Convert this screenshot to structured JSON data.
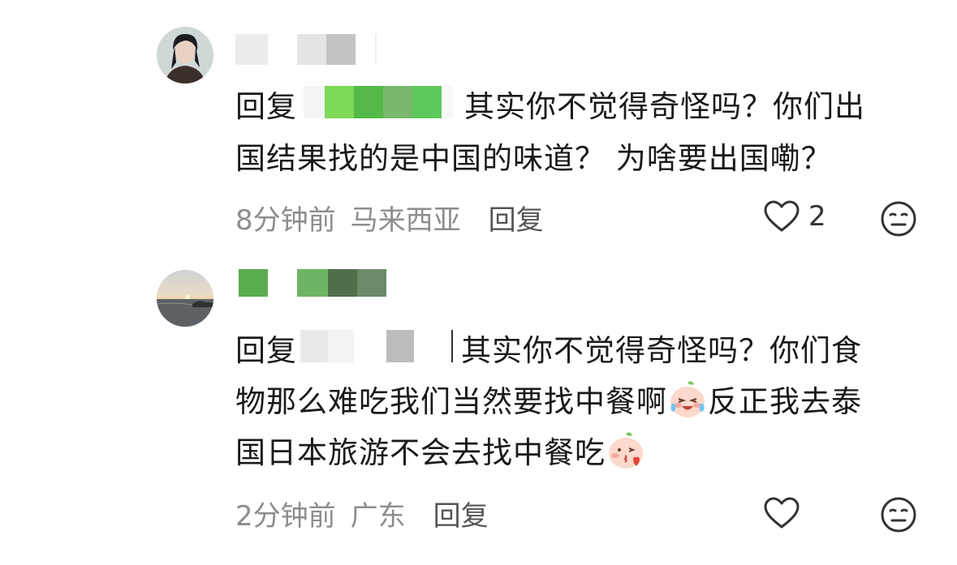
{
  "comments": [
    {
      "reply_prefix": "回复",
      "body_line1": "其实你不觉得奇怪吗？你们出",
      "body_line2": "国结果找的是中国的味道？ 为啥要出国嘞？",
      "time": "8分钟前",
      "location": "马来西亚",
      "reply_label": "回复",
      "like_count": "2",
      "avatar_icon": "man-portrait-avatar",
      "name_mask_colors": [
        "#ececec",
        "#ffffff",
        "#e4e4e4",
        "#c4c4c4",
        "#ffffff"
      ],
      "target_mask_colors": [
        "#7ed957",
        "#54b948",
        "#79b86c",
        "#5ec85a"
      ]
    },
    {
      "reply_prefix": "回复",
      "body_line1": "其实你不觉得奇怪吗？你们食",
      "body_line2": "物那么难吃我们当然要找中餐啊",
      "body_line2b": "反正我去泰",
      "body_line3": "国日本旅游不会去找中餐吃",
      "time": "2分钟前",
      "location": "广东",
      "reply_label": "回复",
      "like_count": "",
      "avatar_icon": "sunset-sea-avatar",
      "emoji1": "crying-laugh-peach-emoji",
      "emoji2": "kiss-peach-emoji",
      "name_mask_colors": [
        "#5aad4e",
        "#ffffff",
        "#6cb464",
        "#4f6f4a",
        "#6b8a6a"
      ],
      "target_mask_colors": [
        "#e8e8e8",
        "#f3f3f3",
        "#ffffff",
        "#bcbcbc",
        "#ffffff"
      ]
    }
  ],
  "icons": {
    "heart": "heart-outline-icon",
    "meh": "neutral-face-icon"
  }
}
